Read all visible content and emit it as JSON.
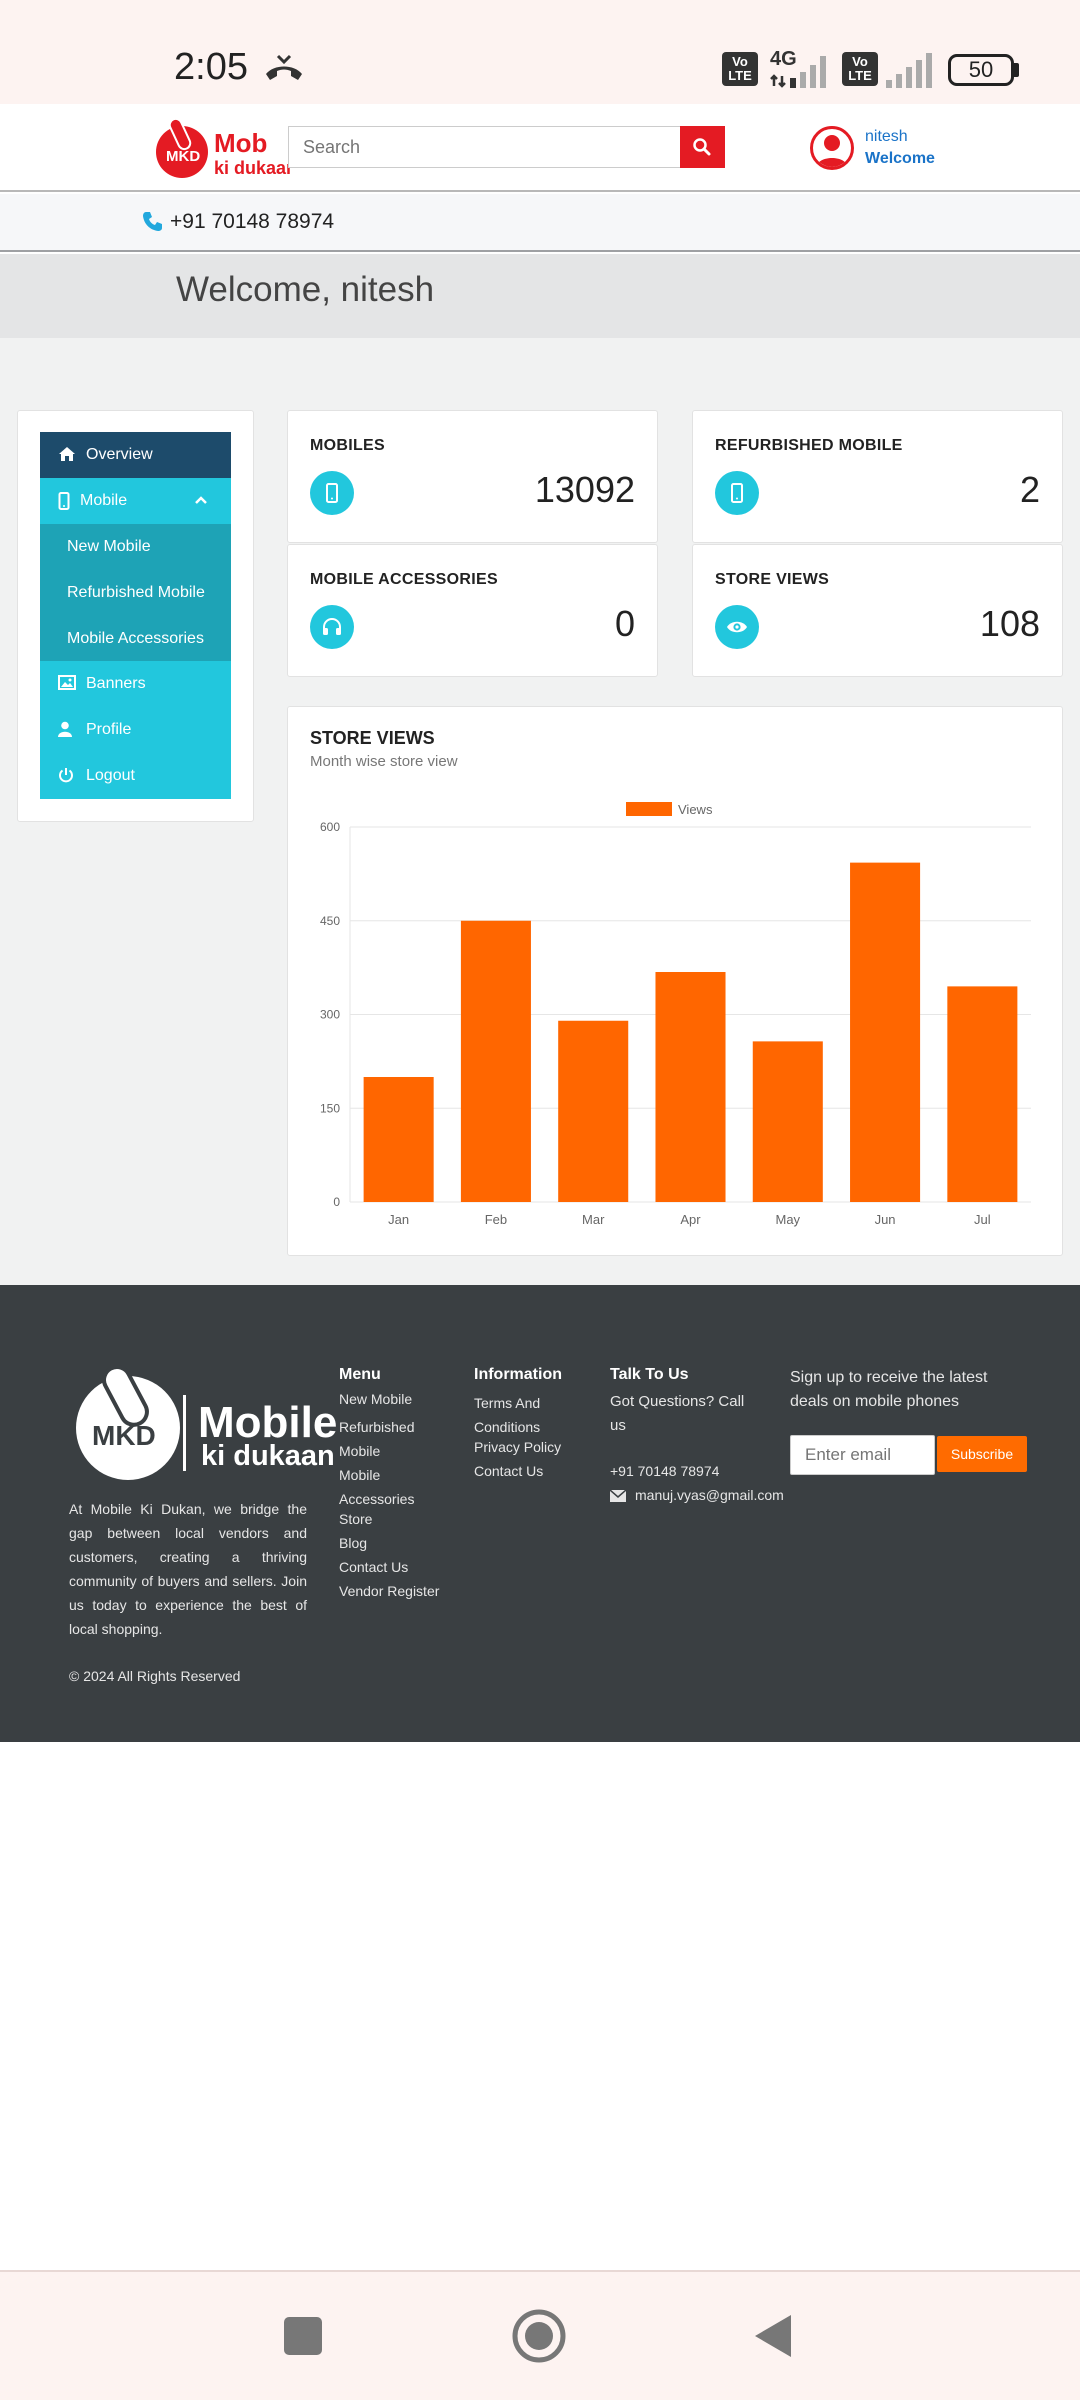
{
  "status_bar": {
    "time": "2:05",
    "network": "4G",
    "volte_line1": "Vo",
    "volte_line2": "LTE",
    "battery": "50"
  },
  "header": {
    "logo_mark": "MKD",
    "logo_word1": "Mob",
    "logo_word2": "ki dukaan",
    "search_placeholder": "Search",
    "user_name": "nitesh",
    "user_greeting": "Welcome"
  },
  "contact_strip": {
    "phone": "+91 70148 78974"
  },
  "welcome": {
    "text": "Welcome, nitesh"
  },
  "sidebar": {
    "items": [
      {
        "label": "Overview"
      },
      {
        "label": "Mobile"
      },
      {
        "label": "New Mobile"
      },
      {
        "label": "Refurbished Mobile"
      },
      {
        "label": "Mobile Accessories"
      },
      {
        "label": "Banners"
      },
      {
        "label": "Profile"
      },
      {
        "label": "Logout"
      }
    ]
  },
  "stats": [
    {
      "title": "MOBILES",
      "value": "13092",
      "icon": "mobile-icon"
    },
    {
      "title": "REFURBISHED MOBILE",
      "value": "2",
      "icon": "mobile-icon"
    },
    {
      "title": "MOBILE ACCESSORIES",
      "value": "0",
      "icon": "headphones-icon"
    },
    {
      "title": "STORE VIEWS",
      "value": "108",
      "icon": "eye-icon"
    }
  ],
  "chart_data": {
    "type": "bar",
    "title": "STORE VIEWS",
    "subtitle": "Month wise store view",
    "categories": [
      "Jan",
      "Feb",
      "Mar",
      "Apr",
      "May",
      "Jun",
      "Jul"
    ],
    "series": [
      {
        "name": "Views",
        "values": [
          200,
          450,
          290,
          368,
          257,
          543,
          345
        ]
      }
    ],
    "ylim": [
      0,
      600
    ],
    "yticks": [
      0,
      150,
      300,
      450,
      600
    ],
    "grid": true,
    "legend_position": "top",
    "bar_color": "#ff6600"
  },
  "footer": {
    "logo_mark": "MKD",
    "logo_word1": "Mobile",
    "logo_word2": "ki dukaan",
    "about": "At Mobile Ki Dukan, we bridge the gap between local vendors and customers, creating a thriving community of buyers and sellers. Join us today to experience the best of local shopping.",
    "copyright": "© 2024 All Rights Reserved",
    "menu_title": "Menu",
    "menu_links": [
      "New Mobile",
      "Refurbished Mobile",
      "Mobile Accessories",
      "Store",
      "Blog",
      "Contact Us",
      "Vendor Register"
    ],
    "info_title": "Information",
    "info_links": [
      "Terms And Conditions",
      "Privacy Policy",
      "Contact Us"
    ],
    "talk_title": "Talk To Us",
    "talk_text": "Got Questions? Call us",
    "talk_phone": "+91 70148 78974",
    "talk_email": "manuj.vyas@gmail.com",
    "newsletter_text": "Sign up to receive the latest deals on mobile phones",
    "email_placeholder": "Enter email",
    "subscribe_label": "Subscribe"
  },
  "colors": {
    "accent_cyan": "#22c7dd",
    "sidebar_dark": "#1d4b6b",
    "brand_red": "#e41b23",
    "orange": "#ff6600",
    "footer_bg": "#3a3f42"
  }
}
